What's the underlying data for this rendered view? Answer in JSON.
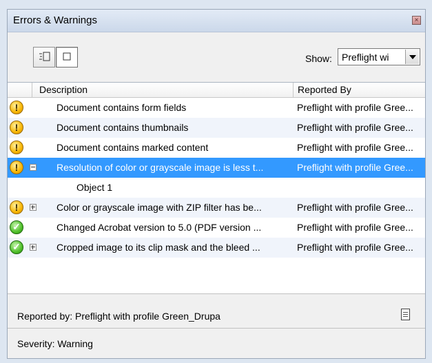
{
  "panel": {
    "title": "Errors & Warnings"
  },
  "toolbar": {
    "show_label": "Show:",
    "show_value": "Preflight wi"
  },
  "grid": {
    "columns": [
      "Description",
      "Reported By"
    ],
    "rows": [
      {
        "status": "warning",
        "expander": "",
        "desc": "Document contains form fields",
        "reported_by": "Preflight with profile Gree..."
      },
      {
        "status": "warning",
        "expander": "",
        "desc": "Document contains thumbnails",
        "reported_by": "Preflight with profile Gree..."
      },
      {
        "status": "warning",
        "expander": "",
        "desc": "Document contains marked content",
        "reported_by": "Preflight with profile Gree..."
      },
      {
        "status": "warning",
        "expander": "minus",
        "desc": "Resolution of color or grayscale image is less t...",
        "reported_by": "Preflight with profile Gree...",
        "selected": true
      },
      {
        "status": "",
        "expander": "",
        "desc": "Object 1",
        "reported_by": "",
        "child": true
      },
      {
        "status": "warning",
        "expander": "plus",
        "desc": "Color or grayscale image with ZIP filter has be...",
        "reported_by": "Preflight with profile Gree..."
      },
      {
        "status": "ok",
        "expander": "",
        "desc": "Changed Acrobat version to 5.0 (PDF version ...",
        "reported_by": "Preflight with profile Gree..."
      },
      {
        "status": "ok",
        "expander": "plus",
        "desc": "Cropped image to its clip mask and the bleed ...",
        "reported_by": "Preflight with profile Gree..."
      }
    ]
  },
  "details": {
    "reported_by": "Reported by: Preflight with profile Green_Drupa",
    "severity": "Severity: Warning"
  },
  "colors": {
    "selection": "#3399ff",
    "warning": "#f7b500",
    "ok": "#4fbf2a"
  }
}
